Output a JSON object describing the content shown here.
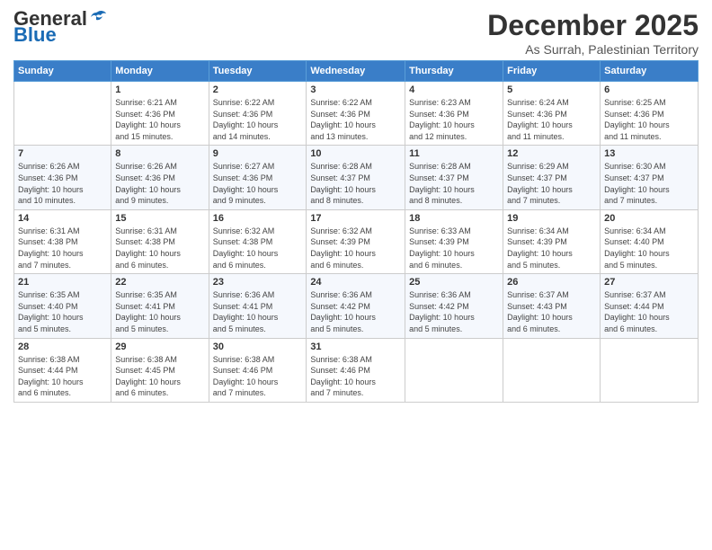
{
  "logo": {
    "general": "General",
    "blue": "Blue"
  },
  "title": "December 2025",
  "subtitle": "As Surrah, Palestinian Territory",
  "days_of_week": [
    "Sunday",
    "Monday",
    "Tuesday",
    "Wednesday",
    "Thursday",
    "Friday",
    "Saturday"
  ],
  "weeks": [
    [
      {
        "day": "",
        "info": ""
      },
      {
        "day": "1",
        "info": "Sunrise: 6:21 AM\nSunset: 4:36 PM\nDaylight: 10 hours\nand 15 minutes."
      },
      {
        "day": "2",
        "info": "Sunrise: 6:22 AM\nSunset: 4:36 PM\nDaylight: 10 hours\nand 14 minutes."
      },
      {
        "day": "3",
        "info": "Sunrise: 6:22 AM\nSunset: 4:36 PM\nDaylight: 10 hours\nand 13 minutes."
      },
      {
        "day": "4",
        "info": "Sunrise: 6:23 AM\nSunset: 4:36 PM\nDaylight: 10 hours\nand 12 minutes."
      },
      {
        "day": "5",
        "info": "Sunrise: 6:24 AM\nSunset: 4:36 PM\nDaylight: 10 hours\nand 11 minutes."
      },
      {
        "day": "6",
        "info": "Sunrise: 6:25 AM\nSunset: 4:36 PM\nDaylight: 10 hours\nand 11 minutes."
      }
    ],
    [
      {
        "day": "7",
        "info": "Sunrise: 6:26 AM\nSunset: 4:36 PM\nDaylight: 10 hours\nand 10 minutes."
      },
      {
        "day": "8",
        "info": "Sunrise: 6:26 AM\nSunset: 4:36 PM\nDaylight: 10 hours\nand 9 minutes."
      },
      {
        "day": "9",
        "info": "Sunrise: 6:27 AM\nSunset: 4:36 PM\nDaylight: 10 hours\nand 9 minutes."
      },
      {
        "day": "10",
        "info": "Sunrise: 6:28 AM\nSunset: 4:37 PM\nDaylight: 10 hours\nand 8 minutes."
      },
      {
        "day": "11",
        "info": "Sunrise: 6:28 AM\nSunset: 4:37 PM\nDaylight: 10 hours\nand 8 minutes."
      },
      {
        "day": "12",
        "info": "Sunrise: 6:29 AM\nSunset: 4:37 PM\nDaylight: 10 hours\nand 7 minutes."
      },
      {
        "day": "13",
        "info": "Sunrise: 6:30 AM\nSunset: 4:37 PM\nDaylight: 10 hours\nand 7 minutes."
      }
    ],
    [
      {
        "day": "14",
        "info": "Sunrise: 6:31 AM\nSunset: 4:38 PM\nDaylight: 10 hours\nand 7 minutes."
      },
      {
        "day": "15",
        "info": "Sunrise: 6:31 AM\nSunset: 4:38 PM\nDaylight: 10 hours\nand 6 minutes."
      },
      {
        "day": "16",
        "info": "Sunrise: 6:32 AM\nSunset: 4:38 PM\nDaylight: 10 hours\nand 6 minutes."
      },
      {
        "day": "17",
        "info": "Sunrise: 6:32 AM\nSunset: 4:39 PM\nDaylight: 10 hours\nand 6 minutes."
      },
      {
        "day": "18",
        "info": "Sunrise: 6:33 AM\nSunset: 4:39 PM\nDaylight: 10 hours\nand 6 minutes."
      },
      {
        "day": "19",
        "info": "Sunrise: 6:34 AM\nSunset: 4:39 PM\nDaylight: 10 hours\nand 5 minutes."
      },
      {
        "day": "20",
        "info": "Sunrise: 6:34 AM\nSunset: 4:40 PM\nDaylight: 10 hours\nand 5 minutes."
      }
    ],
    [
      {
        "day": "21",
        "info": "Sunrise: 6:35 AM\nSunset: 4:40 PM\nDaylight: 10 hours\nand 5 minutes."
      },
      {
        "day": "22",
        "info": "Sunrise: 6:35 AM\nSunset: 4:41 PM\nDaylight: 10 hours\nand 5 minutes."
      },
      {
        "day": "23",
        "info": "Sunrise: 6:36 AM\nSunset: 4:41 PM\nDaylight: 10 hours\nand 5 minutes."
      },
      {
        "day": "24",
        "info": "Sunrise: 6:36 AM\nSunset: 4:42 PM\nDaylight: 10 hours\nand 5 minutes."
      },
      {
        "day": "25",
        "info": "Sunrise: 6:36 AM\nSunset: 4:42 PM\nDaylight: 10 hours\nand 5 minutes."
      },
      {
        "day": "26",
        "info": "Sunrise: 6:37 AM\nSunset: 4:43 PM\nDaylight: 10 hours\nand 6 minutes."
      },
      {
        "day": "27",
        "info": "Sunrise: 6:37 AM\nSunset: 4:44 PM\nDaylight: 10 hours\nand 6 minutes."
      }
    ],
    [
      {
        "day": "28",
        "info": "Sunrise: 6:38 AM\nSunset: 4:44 PM\nDaylight: 10 hours\nand 6 minutes."
      },
      {
        "day": "29",
        "info": "Sunrise: 6:38 AM\nSunset: 4:45 PM\nDaylight: 10 hours\nand 6 minutes."
      },
      {
        "day": "30",
        "info": "Sunrise: 6:38 AM\nSunset: 4:46 PM\nDaylight: 10 hours\nand 7 minutes."
      },
      {
        "day": "31",
        "info": "Sunrise: 6:38 AM\nSunset: 4:46 PM\nDaylight: 10 hours\nand 7 minutes."
      },
      {
        "day": "",
        "info": ""
      },
      {
        "day": "",
        "info": ""
      },
      {
        "day": "",
        "info": ""
      }
    ]
  ]
}
